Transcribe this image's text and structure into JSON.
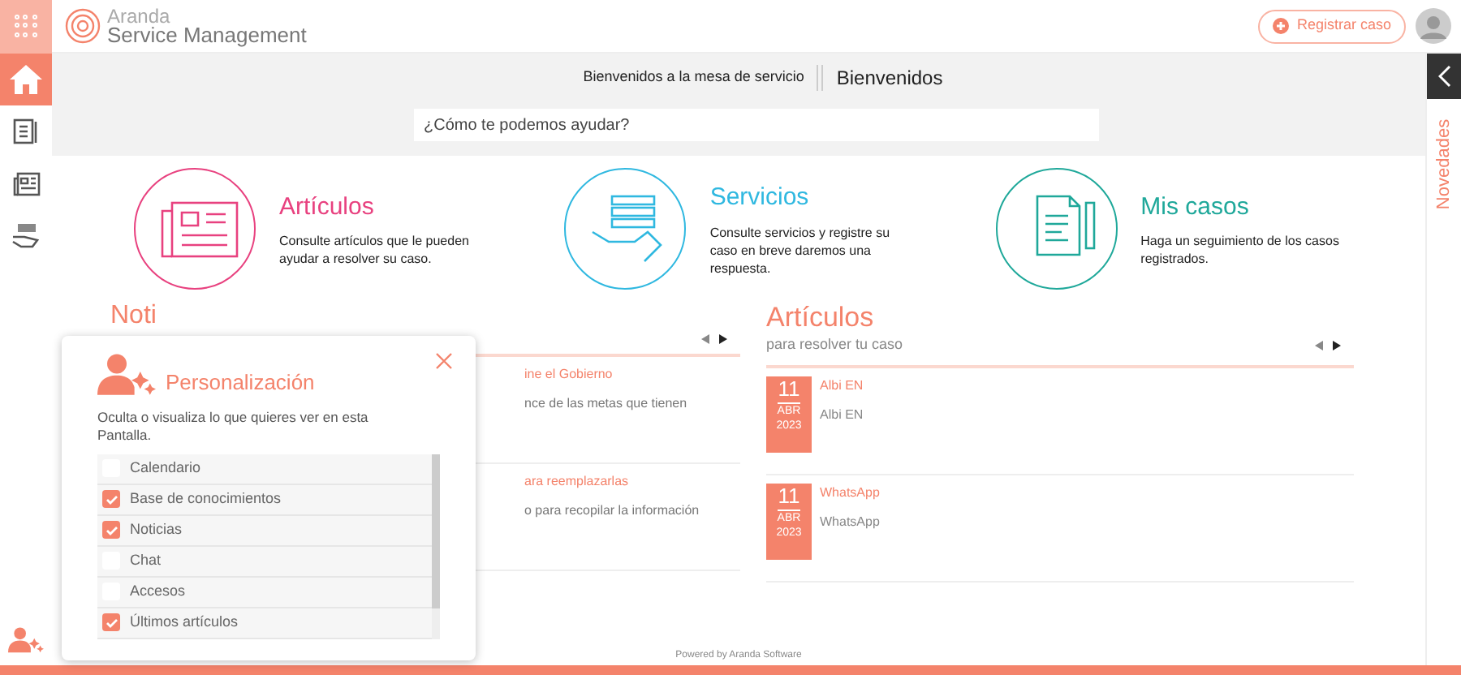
{
  "header": {
    "logo_top": "Aranda",
    "logo_bottom": "Service Management",
    "register_button": "Registrar caso"
  },
  "sidebar": {
    "items": [
      {
        "kind": "home",
        "selected": true
      },
      {
        "kind": "book",
        "selected": false
      },
      {
        "kind": "news",
        "selected": false
      },
      {
        "kind": "hand",
        "selected": false
      }
    ]
  },
  "breadcrumb": {
    "left": "Bienvenidos a la mesa de servicio",
    "right": "Bienvenidos"
  },
  "search": {
    "placeholder": "¿Cómo te podemos ayudar?"
  },
  "cards": [
    {
      "kind": "articles",
      "title": "Artículos",
      "text": "Consulte artículos que le pueden ayudar a resolver su caso.",
      "color": "#e8417f"
    },
    {
      "kind": "services",
      "title": "Servicios",
      "text": "Consulte servicios y registre su caso en breve daremos una respuesta.",
      "color": "#2fb8e0"
    },
    {
      "kind": "cases",
      "title": "Mis casos",
      "text": "Haga un seguimiento de los casos registrados.",
      "color": "#1fa89a"
    }
  ],
  "news": {
    "title": "Noti",
    "items": [
      {
        "title": "ine el Gobierno",
        "text": "nce de las metas que tienen"
      },
      {
        "title": "ara reemplazarlas",
        "text": "o para recopilar la información"
      }
    ]
  },
  "articles": {
    "title": "Artículos",
    "subtitle": "para resolver tu caso",
    "items": [
      {
        "day": "11",
        "month": "ABR",
        "year": "2023",
        "title": "Albi EN",
        "text": "Albi EN"
      },
      {
        "day": "11",
        "month": "ABR",
        "year": "2023",
        "title": "WhatsApp",
        "text": "WhatsApp"
      }
    ]
  },
  "novedades": "Novedades",
  "personalization": {
    "title": "Personalización",
    "description": "Oculta o visualiza lo que quieres ver en esta Pantalla.",
    "options": [
      {
        "label": "Calendario",
        "checked": false
      },
      {
        "label": "Base de conocimientos",
        "checked": true
      },
      {
        "label": "Noticias",
        "checked": true
      },
      {
        "label": "Chat",
        "checked": false
      },
      {
        "label": "Accesos",
        "checked": false
      },
      {
        "label": "Últimos artículos",
        "checked": true
      }
    ]
  },
  "footer": "Powered by Aranda Software"
}
